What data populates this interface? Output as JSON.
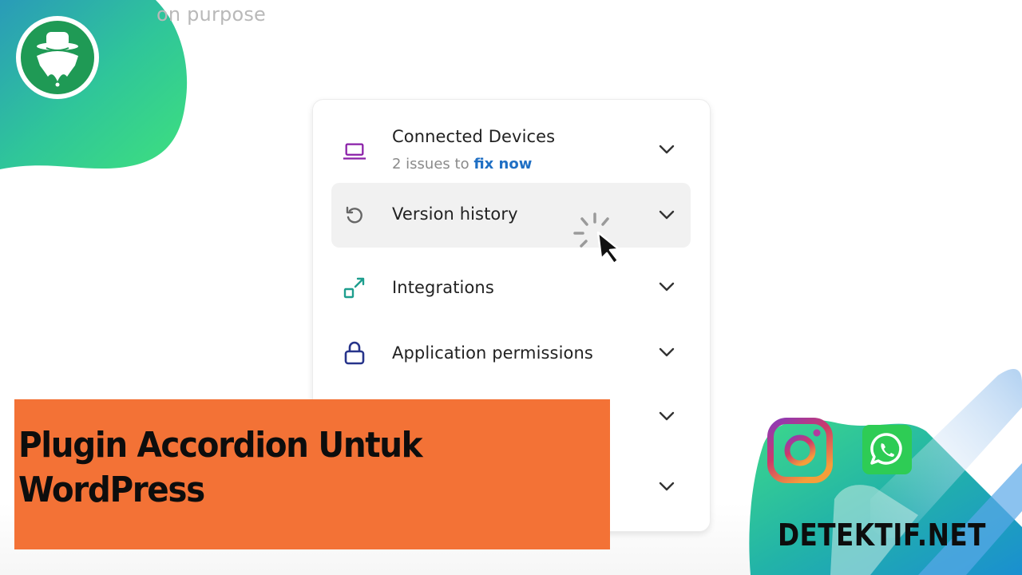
{
  "background_text": {
    "fragment": "on purpose"
  },
  "logo": {
    "name": "detective-logo",
    "bg_color": "#1f9a55"
  },
  "accordion": {
    "items": [
      {
        "label": "Connected Devices",
        "subtitle_prefix": "2 issues to ",
        "subtitle_link": "fix now",
        "icon": "laptop-icon",
        "icon_color": "#8a1fa8",
        "state": "collapsed"
      },
      {
        "label": "Version history",
        "icon": "history-icon",
        "icon_color": "#666666",
        "state": "hovered"
      },
      {
        "label": "Integrations",
        "icon": "external-link-icon",
        "icon_color": "#1e9e8e",
        "state": "collapsed"
      },
      {
        "label": "Application permissions",
        "icon": "lock-icon",
        "icon_color": "#27348b",
        "state": "collapsed"
      },
      {
        "label": "",
        "icon": "",
        "state": "collapsed"
      },
      {
        "label": "",
        "icon": "",
        "state": "collapsed"
      }
    ],
    "link_color": "#1f6fc4"
  },
  "banner": {
    "line1": "Plugin Accordion Untuk",
    "line2": "WordPress",
    "bg_color": "#f37236"
  },
  "social": {
    "instagram": "instagram-icon",
    "whatsapp": "whatsapp-icon",
    "whatsapp_color": "#2ecc55"
  },
  "brand": {
    "text": "DETEKTIF.NET"
  }
}
